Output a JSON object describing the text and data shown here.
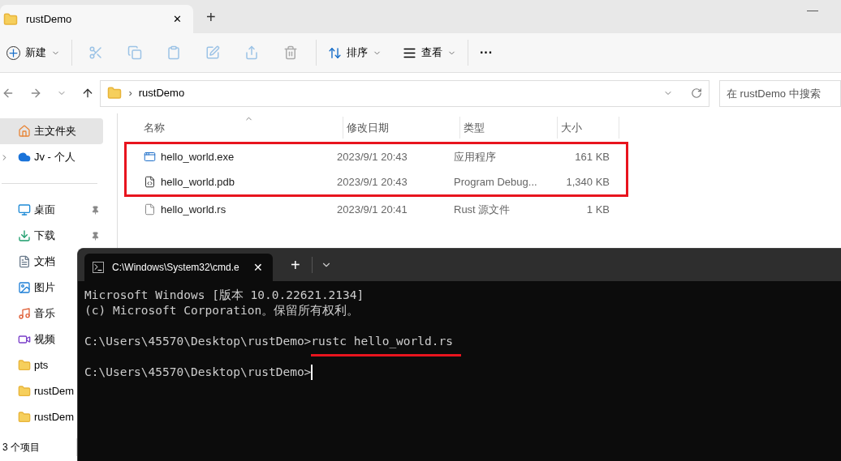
{
  "explorer": {
    "tab": {
      "title": "rustDemo",
      "close": "✕"
    },
    "new_tab": "+",
    "minimize": "—",
    "toolbar": {
      "new": "新建",
      "sort": "排序",
      "view": "查看",
      "more": "···"
    },
    "address": {
      "crumb_separator": "›",
      "path": "rustDemo",
      "search_placeholder": "在 rustDemo 中搜索"
    },
    "sidebar": {
      "items": [
        {
          "label": "主文件夹",
          "selected": true,
          "pinned": false,
          "expander": false
        },
        {
          "label": "Jv - 个人",
          "selected": false,
          "pinned": false,
          "expander": true
        },
        {
          "label": "桌面",
          "selected": false,
          "pinned": true,
          "expander": false
        },
        {
          "label": "下载",
          "selected": false,
          "pinned": true,
          "expander": false
        },
        {
          "label": "文档",
          "selected": false,
          "pinned": false,
          "expander": false
        },
        {
          "label": "图片",
          "selected": false,
          "pinned": false,
          "expander": false
        },
        {
          "label": "音乐",
          "selected": false,
          "pinned": false,
          "expander": false
        },
        {
          "label": "视频",
          "selected": false,
          "pinned": false,
          "expander": false
        },
        {
          "label": "pts",
          "selected": false,
          "pinned": false,
          "expander": false
        },
        {
          "label": "rustDem",
          "selected": false,
          "pinned": false,
          "expander": false
        },
        {
          "label": "rustDem",
          "selected": false,
          "pinned": false,
          "expander": false
        }
      ]
    },
    "table": {
      "columns": [
        "名称",
        "修改日期",
        "类型",
        "大小"
      ],
      "rows": [
        {
          "name": "hello_world.exe",
          "date": "2023/9/1 20:43",
          "type": "应用程序",
          "size": "161 KB",
          "boxed": true
        },
        {
          "name": "hello_world.pdb",
          "date": "2023/9/1 20:43",
          "type": "Program Debug...",
          "size": "1,340 KB",
          "boxed": true
        },
        {
          "name": "hello_world.rs",
          "date": "2023/9/1 20:41",
          "type": "Rust 源文件",
          "size": "1 KB",
          "boxed": false
        }
      ]
    },
    "status_bar": "3 个项目"
  },
  "terminal": {
    "tab_title": "C:\\Windows\\System32\\cmd.e",
    "close": "✕",
    "new_tab": "+",
    "lines": [
      {
        "kind": "output",
        "text": "Microsoft Windows [版本 10.0.22621.2134]"
      },
      {
        "kind": "output",
        "text": "(c) Microsoft Corporation。保留所有权利。"
      },
      {
        "kind": "blank"
      },
      {
        "kind": "prompt",
        "prompt": "C:\\Users\\45570\\Desktop\\rustDemo>",
        "command": "rustc hello_world.rs",
        "underlined": true,
        "cursor": false
      },
      {
        "kind": "blank"
      },
      {
        "kind": "prompt",
        "prompt": "C:\\Users\\45570\\Desktop\\rustDemo>",
        "cursor": true
      }
    ]
  }
}
